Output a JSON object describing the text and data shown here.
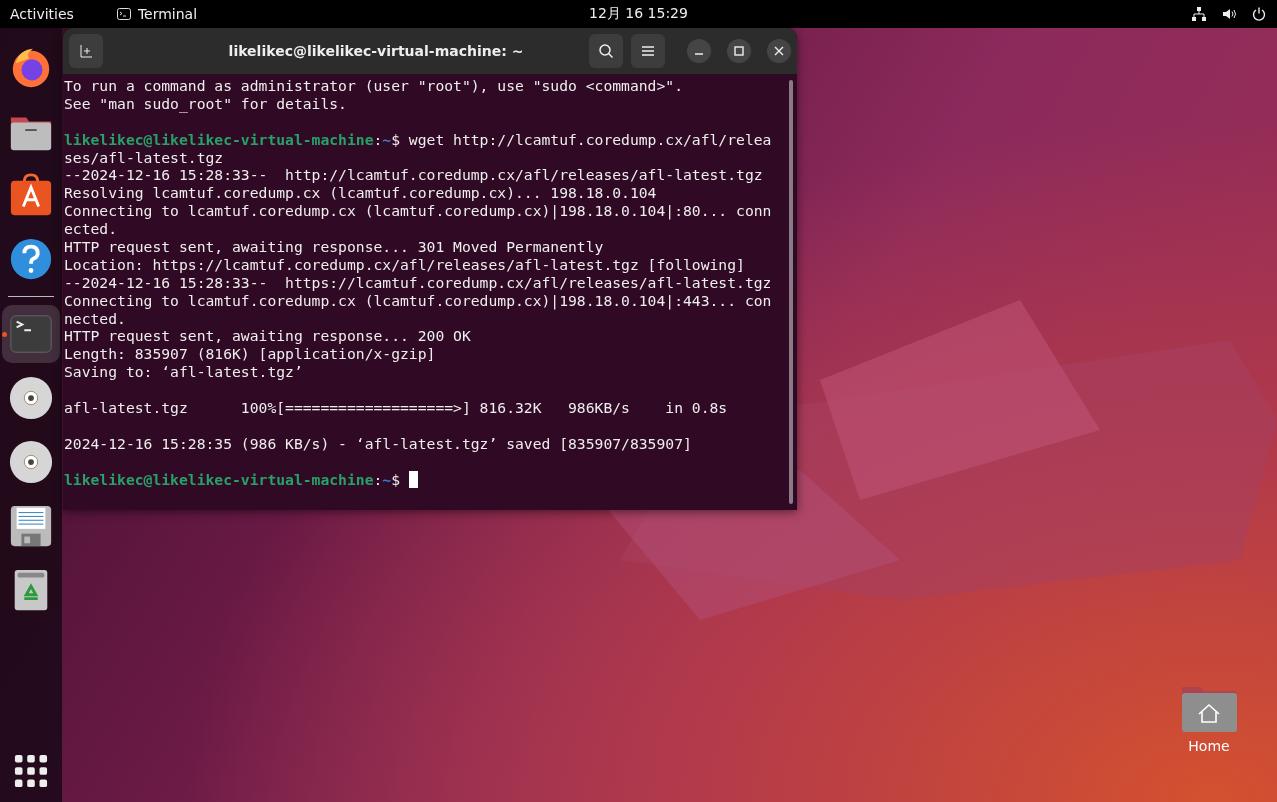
{
  "top_bar": {
    "activities": "Activities",
    "app_menu": "Terminal",
    "clock": "12月 16  15:29"
  },
  "dock": [
    {
      "kind": "firefox",
      "running": false
    },
    {
      "kind": "files",
      "running": false
    },
    {
      "kind": "software",
      "running": false
    },
    {
      "kind": "help",
      "running": false
    },
    {
      "kind": "terminal",
      "running": true
    },
    {
      "kind": "disc",
      "running": false
    },
    {
      "kind": "disc",
      "running": false
    },
    {
      "kind": "floppy",
      "running": false
    },
    {
      "kind": "trash",
      "running": false
    }
  ],
  "terminal": {
    "title": "likelikec@likelikec-virtual-machine: ~",
    "lines": [
      {
        "kind": "text",
        "text": "To run a command as administrator (user \"root\"), use \"sudo <command>\"."
      },
      {
        "kind": "text",
        "text": "See \"man sudo_root\" for details."
      },
      {
        "kind": "blank"
      },
      {
        "kind": "prompt",
        "user": "likelikec@likelikec-virtual-machine",
        "colon": ":",
        "path": "~",
        "symbol": "$",
        "command": "wget http://lcamtuf.coredump.cx/afl/relea"
      },
      {
        "kind": "text",
        "text": "ses/afl-latest.tgz"
      },
      {
        "kind": "text",
        "text": "--2024-12-16 15:28:33--  http://lcamtuf.coredump.cx/afl/releases/afl-latest.tgz"
      },
      {
        "kind": "text",
        "text": "Resolving lcamtuf.coredump.cx (lcamtuf.coredump.cx)... 198.18.0.104"
      },
      {
        "kind": "text",
        "text": "Connecting to lcamtuf.coredump.cx (lcamtuf.coredump.cx)|198.18.0.104|:80... conn"
      },
      {
        "kind": "text",
        "text": "ected."
      },
      {
        "kind": "text",
        "text": "HTTP request sent, awaiting response... 301 Moved Permanently"
      },
      {
        "kind": "text",
        "text": "Location: https://lcamtuf.coredump.cx/afl/releases/afl-latest.tgz [following]"
      },
      {
        "kind": "text",
        "text": "--2024-12-16 15:28:33--  https://lcamtuf.coredump.cx/afl/releases/afl-latest.tgz"
      },
      {
        "kind": "text",
        "text": "Connecting to lcamtuf.coredump.cx (lcamtuf.coredump.cx)|198.18.0.104|:443... con"
      },
      {
        "kind": "text",
        "text": "nected."
      },
      {
        "kind": "text",
        "text": "HTTP request sent, awaiting response... 200 OK"
      },
      {
        "kind": "text",
        "text": "Length: 835907 (816K) [application/x-gzip]"
      },
      {
        "kind": "text",
        "text": "Saving to: ‘afl-latest.tgz’"
      },
      {
        "kind": "blank"
      },
      {
        "kind": "text",
        "text": "afl-latest.tgz      100%[===================>] 816.32K   986KB/s    in 0.8s"
      },
      {
        "kind": "blank"
      },
      {
        "kind": "text",
        "text": "2024-12-16 15:28:35 (986 KB/s) - ‘afl-latest.tgz’ saved [835907/835907]"
      },
      {
        "kind": "blank"
      },
      {
        "kind": "prompt",
        "user": "likelikec@likelikec-virtual-machine",
        "colon": ":",
        "path": "~",
        "symbol": "$",
        "cursor": true
      }
    ]
  },
  "desktop_icons": [
    {
      "label": "Home"
    }
  ]
}
